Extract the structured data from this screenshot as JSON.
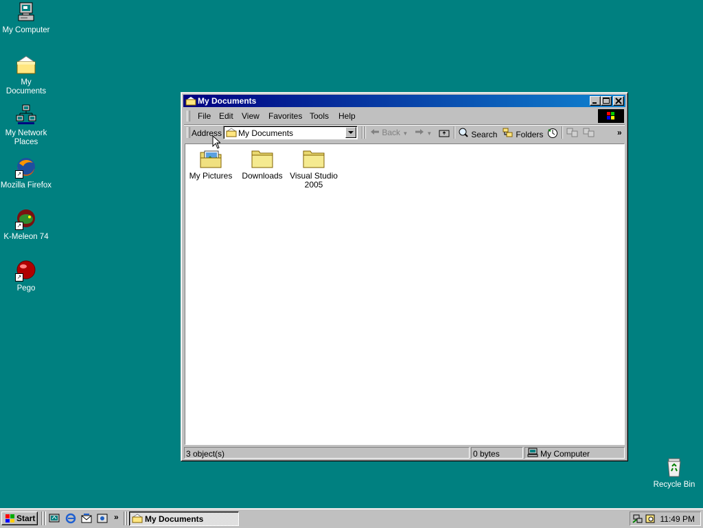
{
  "desktop": {
    "icons": [
      {
        "label": "My Computer",
        "icon": "my-computer-icon"
      },
      {
        "label": "My Documents",
        "icon": "my-documents-icon"
      },
      {
        "label": "My Network Places",
        "icon": "network-places-icon"
      },
      {
        "label": "Mozilla Firefox",
        "icon": "firefox-icon"
      },
      {
        "label": "K-Meleon 74",
        "icon": "k-meleon-icon"
      },
      {
        "label": "Pego",
        "icon": "pego-icon"
      }
    ],
    "recycle_bin": "Recycle Bin",
    "background_color": "#008080"
  },
  "window": {
    "title": "My Documents",
    "menu": [
      "File",
      "Edit",
      "View",
      "Favorites",
      "Tools",
      "Help"
    ],
    "address": {
      "label": "Address",
      "value": "My Documents"
    },
    "toolbar": {
      "back": "Back",
      "search": "Search",
      "folders": "Folders"
    },
    "items": [
      {
        "label": "My Pictures",
        "icon": "pictures-folder-icon"
      },
      {
        "label": "Downloads",
        "icon": "folder-icon"
      },
      {
        "label": "Visual Studio 2005",
        "icon": "folder-icon"
      }
    ],
    "status": {
      "objects": "3 object(s)",
      "size": "0 bytes",
      "location": "My Computer"
    }
  },
  "taskbar": {
    "start": "Start",
    "task": "My Documents",
    "clock": "11:49 PM",
    "more": "»"
  },
  "colors": {
    "titlebar_start": "#000080",
    "titlebar_end": "#1084d0",
    "face": "#c0c0c0"
  }
}
